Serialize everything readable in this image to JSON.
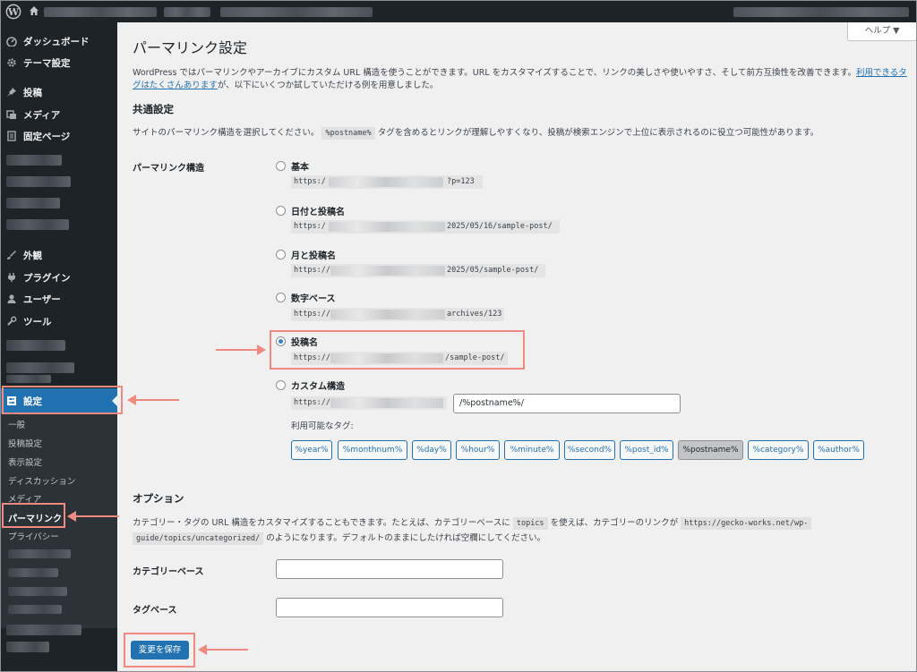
{
  "colors": {
    "accent": "#2271b1",
    "highlight": "#f08a80",
    "sidebar": "#1d2327"
  },
  "sidebar": {
    "dashboard": "ダッシュボード",
    "theme_settings": "テーマ設定",
    "posts": "投稿",
    "media": "メディア",
    "pages": "固定ページ",
    "appearance": "外観",
    "plugins": "プラグイン",
    "users": "ユーザー",
    "tools": "ツール",
    "settings": "設定",
    "submenu": {
      "general": "一般",
      "writing": "投稿設定",
      "reading": "表示設定",
      "discussion": "ディスカッション",
      "media": "メディア",
      "permalinks": "パーマリンク",
      "privacy": "プライバシー"
    }
  },
  "header": {
    "title": "パーマリンク設定",
    "help": "ヘルプ ▼",
    "intro": "WordPress ではパーマリンクやアーカイブにカスタム URL 構造を使うことができます。URL をカスタマイズすることで、リンクの美しさや使いやすさ、そして前方互換性を改善できます。",
    "intro_link": "利用できるタグはたくさんあります",
    "intro_end": "が、以下にいくつか試していただける例を用意しました。"
  },
  "common": {
    "heading": "共通設定",
    "desc_before": "サイトのパーマリンク構造を選択してください。",
    "desc_code": "%postname%",
    "desc_after": "タグを含めるとリンクが理解しやすくなり、投稿が検索エンジンで上位に表示されるのに役立つ可能性があります。",
    "structure_label": "パーマリンク構造",
    "options": [
      {
        "label": "基本",
        "prefix": "https:/",
        "suffix": "?p=123"
      },
      {
        "label": "日付と投稿名",
        "prefix": "https:/",
        "suffix": "2025/05/16/sample-post/"
      },
      {
        "label": "月と投稿名",
        "prefix": "https://",
        "suffix": "2025/05/sample-post/"
      },
      {
        "label": "数字ベース",
        "prefix": "https://",
        "suffix": "archives/123"
      },
      {
        "label": "投稿名",
        "prefix": "https://",
        "suffix": "/sample-post/"
      },
      {
        "label": "カスタム構造",
        "prefix": "https://",
        "suffix": ""
      }
    ],
    "custom_value": "/%postname%/",
    "available_tags_label": "利用可能なタグ:",
    "tags": [
      "%year%",
      "%monthnum%",
      "%day%",
      "%hour%",
      "%minute%",
      "%second%",
      "%post_id%",
      "%postname%",
      "%category%",
      "%author%"
    ]
  },
  "options": {
    "heading": "オプション",
    "desc_1": "カテゴリー・タグの URL 構造をカスタマイズすることもできます。たとえば、カテゴリーベースに",
    "desc_code1": "topics",
    "desc_2": "を使えば、カテゴリーのリンクが",
    "desc_code2a": "https://gecko-works.net/wp-",
    "desc_code2b": "guide/topics/uncategorized/",
    "desc_3": "のようになります。デフォルトのままにしたければ空欄にしてください。",
    "category_base_label": "カテゴリーベース",
    "tag_base_label": "タグベース",
    "category_base_value": "",
    "tag_base_value": ""
  },
  "save_label": "変更を保存"
}
